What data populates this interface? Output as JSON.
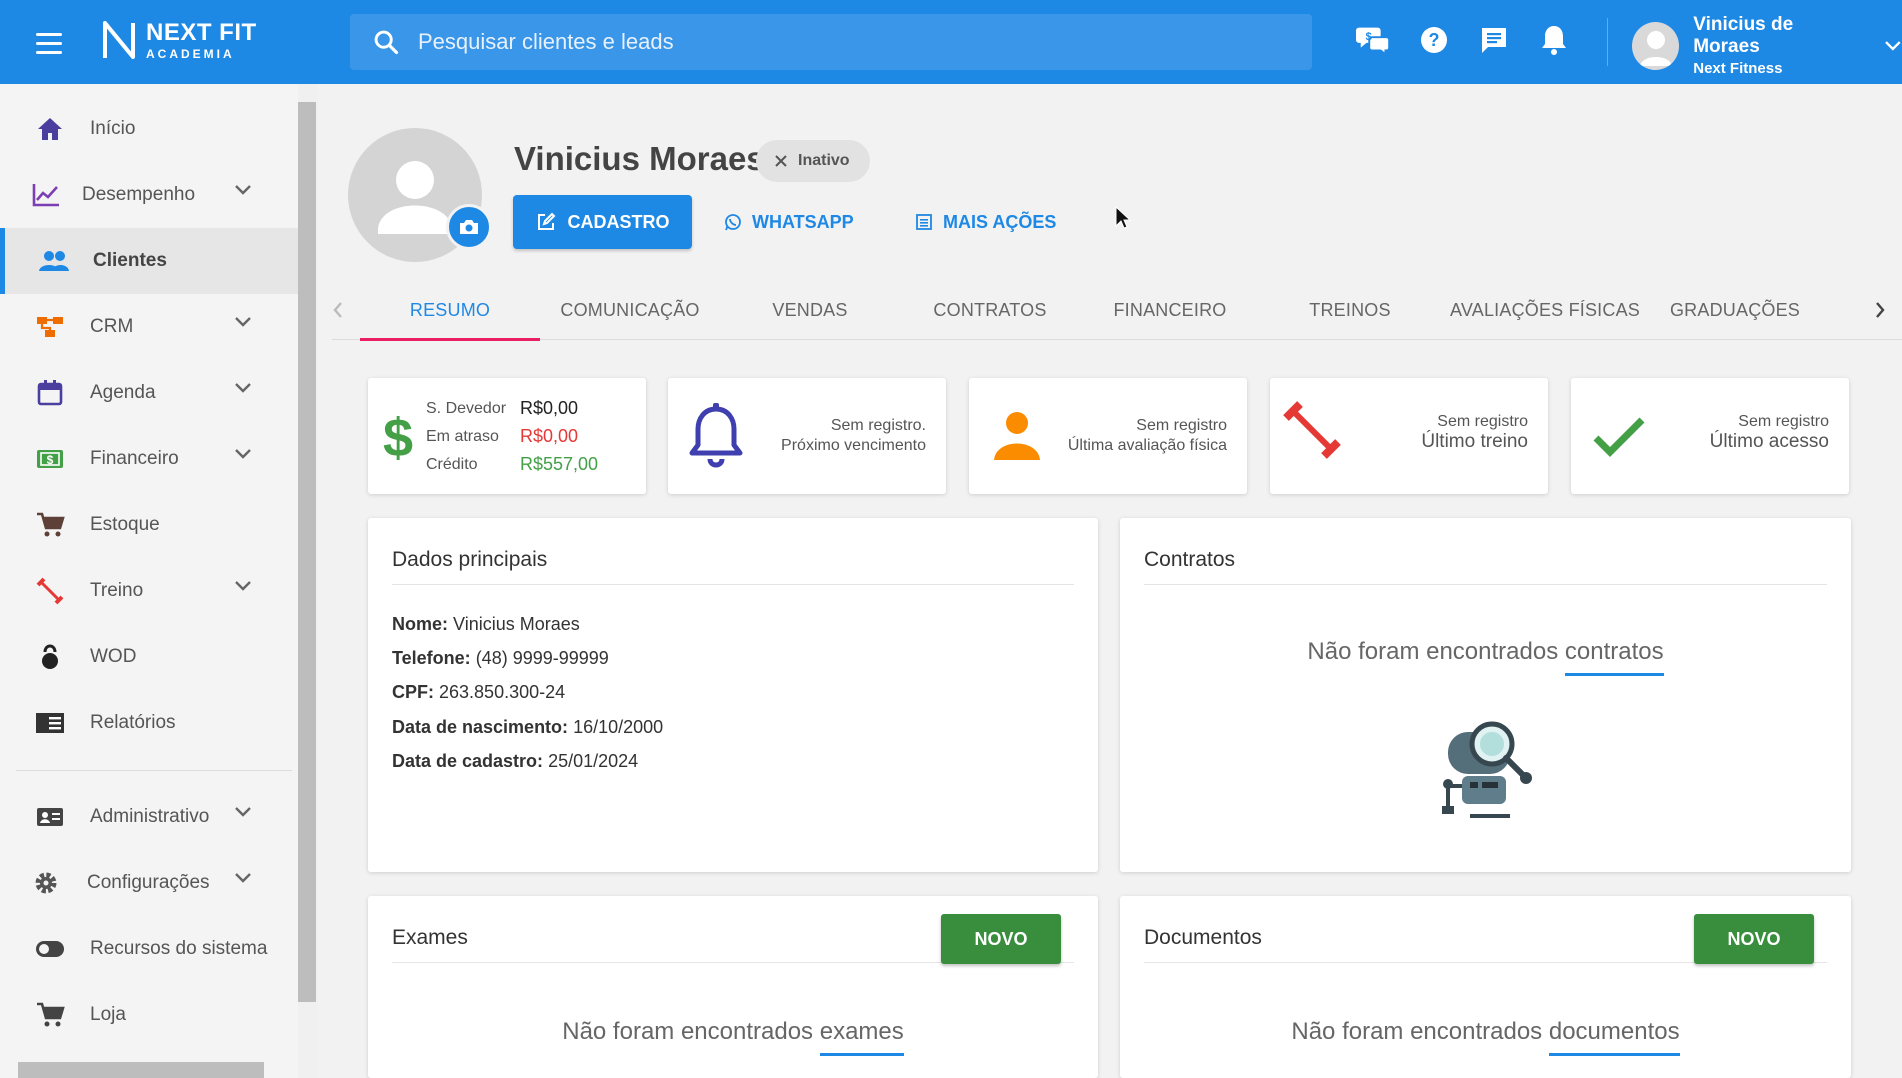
{
  "app": {
    "logo_title": "NEXT FIT",
    "logo_sub": "ACADEMIA"
  },
  "search": {
    "placeholder": "Pesquisar clientes e leads"
  },
  "top_icons": [
    "chat-money-icon",
    "help-icon",
    "message-icon",
    "bell-icon"
  ],
  "user": {
    "name": "Vinicius de Moraes",
    "org": "Next Fitness"
  },
  "sidebar": {
    "items": [
      {
        "label": "Início",
        "icon": "home-icon"
      },
      {
        "label": "Desempenho",
        "icon": "chart-line-icon"
      },
      {
        "label": "Clientes",
        "icon": "people-icon"
      },
      {
        "label": "CRM",
        "icon": "crm-icon"
      },
      {
        "label": "Agenda",
        "icon": "calendar-icon"
      },
      {
        "label": "Financeiro",
        "icon": "money-icon"
      },
      {
        "label": "Estoque",
        "icon": "cart-icon"
      },
      {
        "label": "Treino",
        "icon": "dumbbell-icon"
      },
      {
        "label": "WOD",
        "icon": "kettlebell-icon"
      },
      {
        "label": "Relatórios",
        "icon": "report-icon"
      },
      {
        "label": "Administrativo",
        "icon": "id-card-icon"
      },
      {
        "label": "Configurações",
        "icon": "gear-icon"
      },
      {
        "label": "Recursos do sistema",
        "icon": "toggle-icon"
      },
      {
        "label": "Loja",
        "icon": "cart-icon"
      }
    ],
    "active": "Clientes"
  },
  "profile": {
    "name": "Vinicius Moraes",
    "status": "Inativo",
    "actions": {
      "cadastro": "CADASTRO",
      "whatsapp": "WHATSAPP",
      "mais_acoes": "MAIS AÇÕES"
    }
  },
  "tabs": [
    "RESUMO",
    "COMUNICAÇÃO",
    "VENDAS",
    "CONTRATOS",
    "FINANCEIRO",
    "TREINOS",
    "AVALIAÇÕES FÍSICAS",
    "GRADUAÇÕES"
  ],
  "active_tab": "RESUMO",
  "stats": {
    "finance": {
      "devedor_label": "S. Devedor",
      "devedor_value": "R$0,00",
      "atraso_label": "Em atraso",
      "atraso_value": "R$0,00",
      "credito_label": "Crédito",
      "credito_value": "R$557,00"
    },
    "vencimento": {
      "line1": "Sem registro.",
      "line2": "Próximo vencimento"
    },
    "avaliacao": {
      "line1": "Sem registro",
      "line2": "Última avaliação física"
    },
    "treino": {
      "line1": "Sem registro",
      "line2": "Último treino"
    },
    "acesso": {
      "line1": "Sem registro",
      "line2": "Último acesso"
    }
  },
  "colors": {
    "primary": "#1e88e5",
    "success": "#388e3c",
    "danger": "#e53935",
    "warning": "#fb8c00",
    "tab_indicator": "#e91e63"
  },
  "dados": {
    "title": "Dados principais",
    "fields": [
      {
        "label": "Nome:",
        "value": "Vinicius Moraes"
      },
      {
        "label": "Telefone:",
        "value": "(48) 9999-99999"
      },
      {
        "label": "CPF:",
        "value": "263.850.300-24"
      },
      {
        "label": "Data de nascimento:",
        "value": "16/10/2000"
      },
      {
        "label": "Data de cadastro:",
        "value": "25/01/2024"
      }
    ]
  },
  "contratos": {
    "title": "Contratos",
    "empty_prefix": "Não foram encontrados ",
    "empty_word": "contratos"
  },
  "exames": {
    "title": "Exames",
    "button": "NOVO",
    "empty_prefix": "Não foram encontrados ",
    "empty_word": "exames"
  },
  "documentos": {
    "title": "Documentos",
    "button": "NOVO",
    "empty_prefix": "Não foram encontrados ",
    "empty_word": "documentos"
  }
}
